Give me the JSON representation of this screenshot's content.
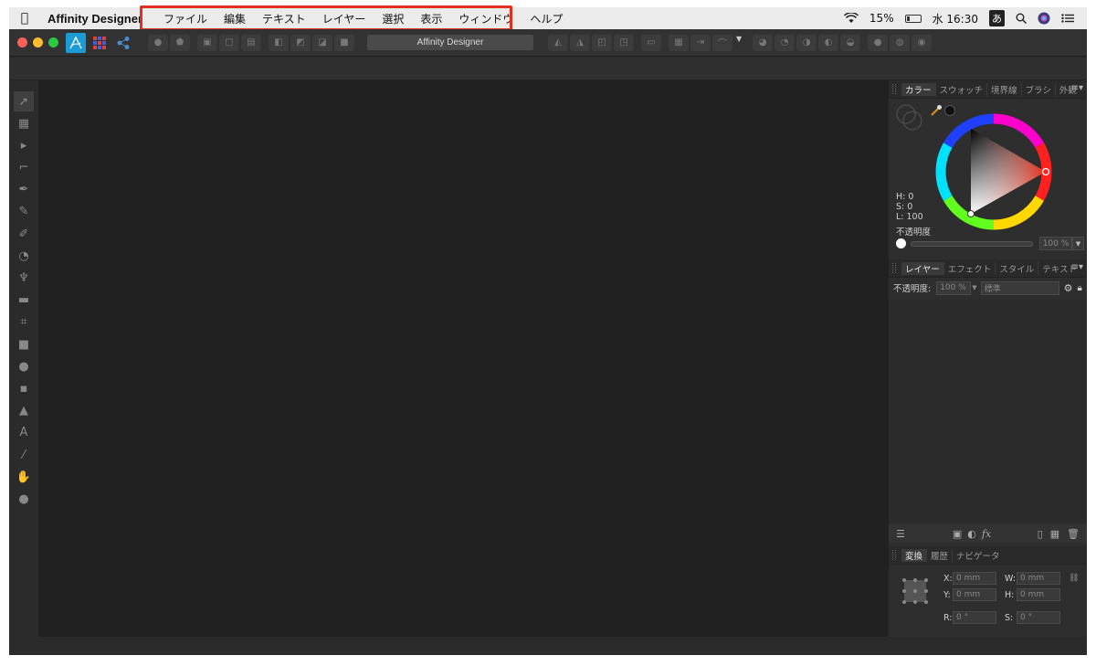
{
  "menubar": {
    "app_name": "Affinity Designer",
    "items": [
      "ファイル",
      "編集",
      "テキスト",
      "レイヤー",
      "選択",
      "表示",
      "ウィンドウ",
      "ヘルプ"
    ],
    "battery": "15%",
    "clock": "水 16:30",
    "ime": "あ"
  },
  "toolbar": {
    "doc_title": "Affinity Designer"
  },
  "color_panel": {
    "tabs": [
      "カラー",
      "スウォッチ",
      "境界線",
      "ブラシ",
      "外観"
    ],
    "h": "H: 0",
    "s": "S: 0",
    "l": "L: 100",
    "opacity_label": "不透明度",
    "opacity_value": "100 %"
  },
  "layers_panel": {
    "tabs": [
      "レイヤー",
      "エフェクト",
      "スタイル",
      "テキスト"
    ],
    "opacity_label": "不透明度:",
    "opacity_value": "100 %",
    "blend_mode": "標準"
  },
  "transform_panel": {
    "tabs": [
      "変換",
      "履歴",
      "ナビゲータ"
    ],
    "x_label": "X:",
    "x_value": "0 mm",
    "y_label": "Y:",
    "y_value": "0 mm",
    "w_label": "W:",
    "w_value": "0 mm",
    "h_label": "H:",
    "h_value": "0 mm",
    "r_label": "R:",
    "r_value": "0 °",
    "s_label": "S:",
    "s_value": "0 °"
  },
  "colors": {
    "highlight": "#e03020",
    "canvas": "#212121",
    "accent": "#1d9bd6"
  }
}
